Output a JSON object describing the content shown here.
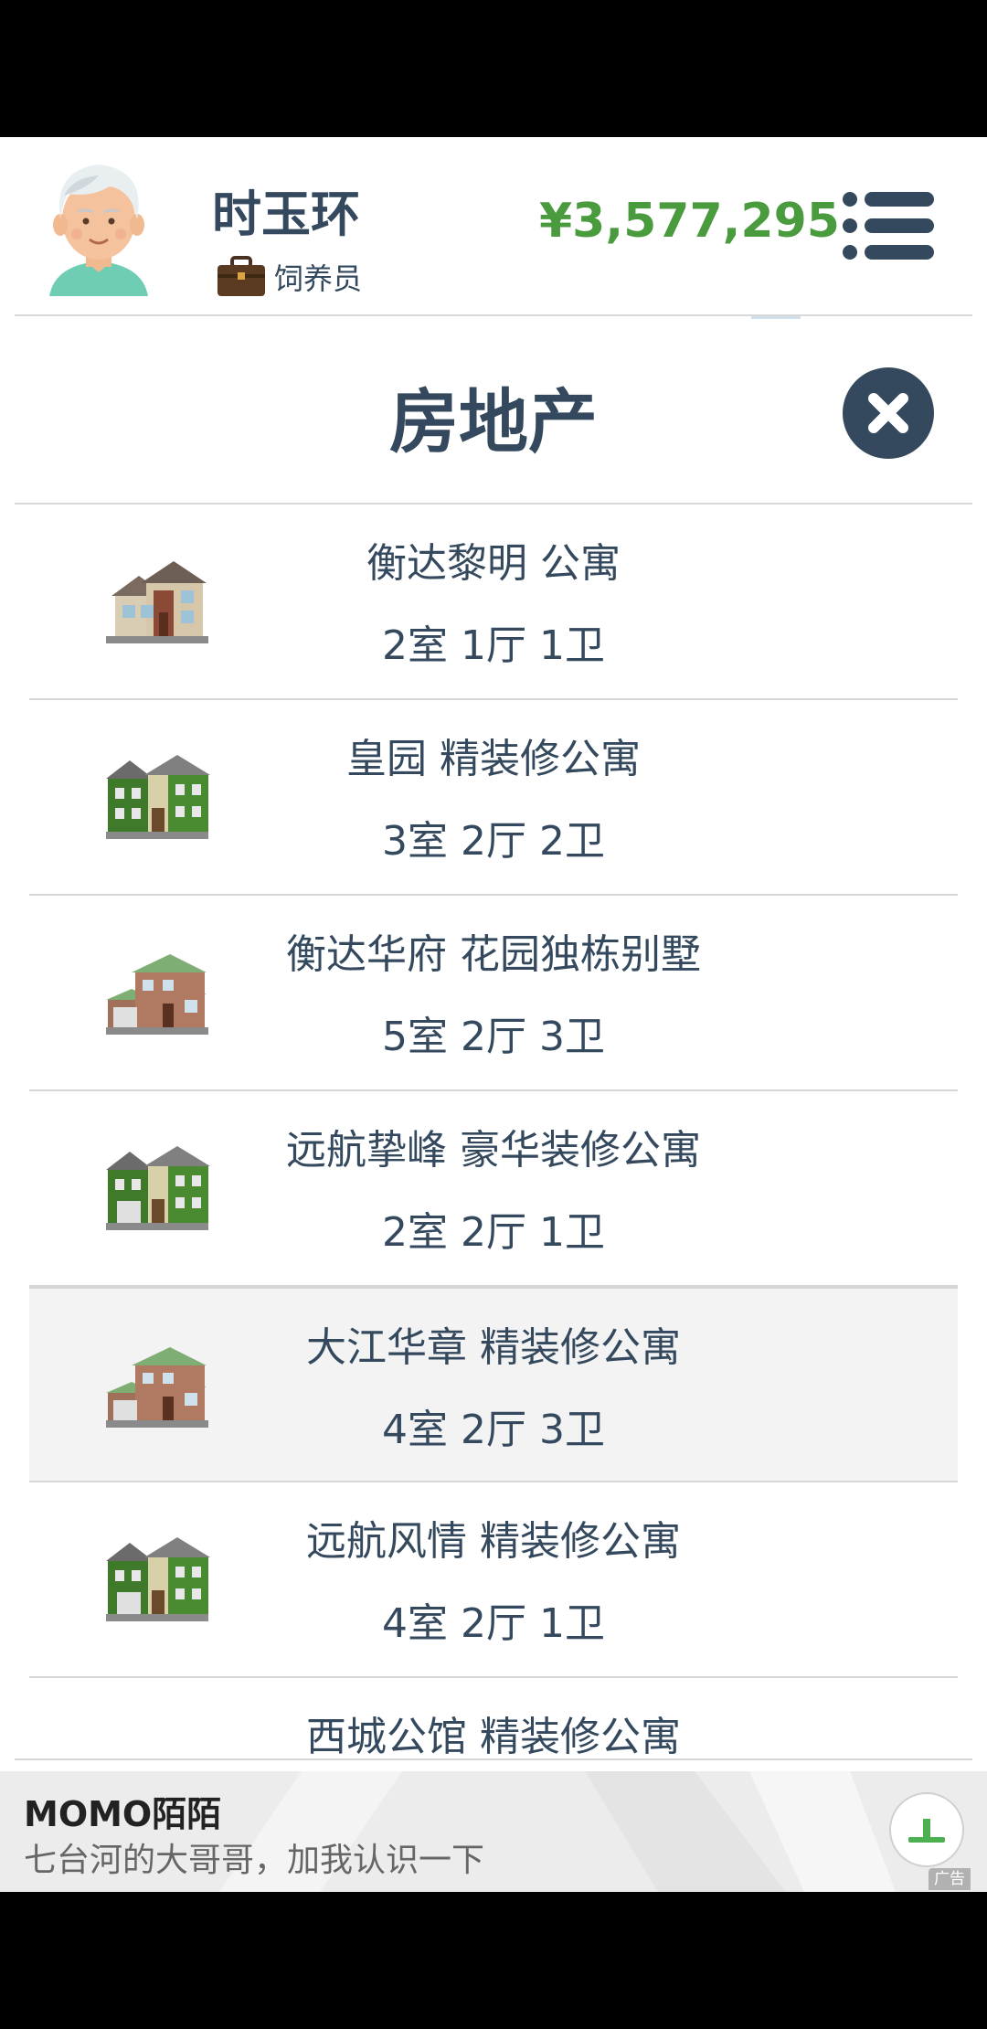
{
  "header": {
    "user_name": "时玉环",
    "job_title": "饲养员",
    "money": "¥3,577,295",
    "icons": {
      "avatar": "elderly-woman-avatar",
      "job": "briefcase-icon",
      "menu": "menu-icon"
    }
  },
  "page": {
    "title": "房地产",
    "close_icon": "close-icon"
  },
  "properties": [
    {
      "name": "衡达黎明 公寓",
      "layout": "2室 1厅 1卫",
      "icon": "house-beige-icon"
    },
    {
      "name": "皇园 精装修公寓",
      "layout": "3室 2厅 2卫",
      "icon": "house-green-icon"
    },
    {
      "name": "衡达华府 花园独栋别墅",
      "layout": "5室 2厅 3卫",
      "icon": "house-brick-icon"
    },
    {
      "name": "远航挚峰 豪华装修公寓",
      "layout": "2室 2厅 1卫",
      "icon": "house-green-icon"
    },
    {
      "name": "大江华章 精装修公寓",
      "layout": "4室 2厅 3卫",
      "icon": "house-brick-icon"
    },
    {
      "name": "远航风情 精装修公寓",
      "layout": "4室 2厅 1卫",
      "icon": "house-green-icon"
    },
    {
      "name": "西城公馆 精装修公寓",
      "layout": "",
      "icon": "house-green-icon"
    }
  ],
  "ad": {
    "brand": "MOMO陌陌",
    "text": "七台河的大哥哥，加我认识一下",
    "tag": "广告",
    "button_icon": "download-icon"
  },
  "colors": {
    "primary_text": "#34495e",
    "money_green": "#4a9a3e",
    "highlight_row": "#f3f3f3"
  }
}
